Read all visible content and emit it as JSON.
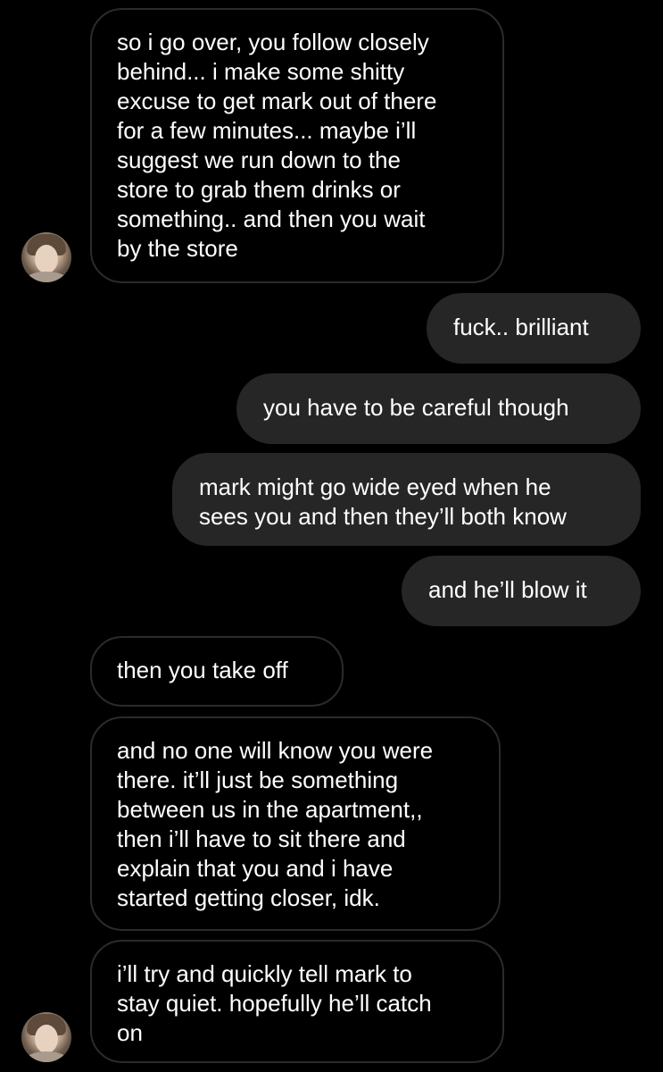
{
  "conversation": {
    "messages": [
      {
        "sender": "them",
        "text": "so i go over, you follow closely\nbehind... i make some shitty\nexcuse to get mark out of there\nfor a few minutes... maybe i’ll\nsuggest we run down to the\nstore to grab them drinks or\nsomething.. and then you wait\nby the store"
      },
      {
        "sender": "me",
        "text": "fuck.. brilliant"
      },
      {
        "sender": "me",
        "text": "you have to be careful though"
      },
      {
        "sender": "me",
        "text": "mark might go wide eyed when he\nsees you and then they’ll both know"
      },
      {
        "sender": "me",
        "text": "and he’ll blow it"
      },
      {
        "sender": "them",
        "text": "then you take off"
      },
      {
        "sender": "them",
        "text": "and no one will know you were\nthere. it’ll just be something\nbetween us in the apartment,,\nthen i’ll have to sit there and\nexplain that you and i have\nstarted getting closer, idk."
      },
      {
        "sender": "them",
        "text": "i’ll try and quickly tell mark to\nstay quiet. hopefully he’ll catch\non"
      }
    ]
  },
  "colors": {
    "background": "#000000",
    "incoming_border": "#2b2b2b",
    "outgoing_fill": "#262626",
    "text": "#ffffff"
  }
}
